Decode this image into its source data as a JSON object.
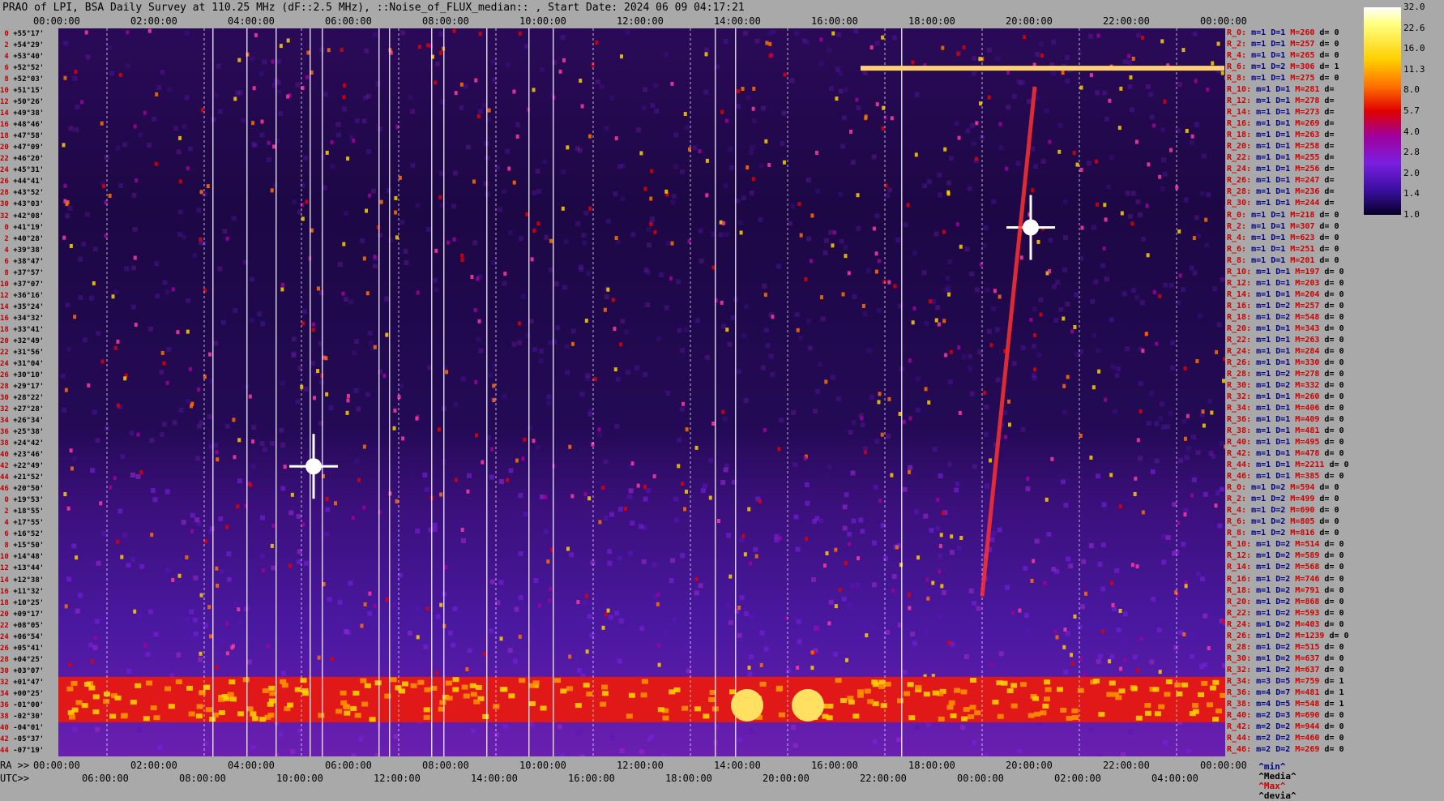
{
  "title": "PRAO of LPI, BSA Daily Survey at 110.25 MHz (dF::2.5 MHz), ::Noise_of_FLUX_median:: , Start Date: 2024 06 09 04:17:21",
  "top_axis": [
    "00:00:00",
    "02:00:00",
    "04:00:00",
    "06:00:00",
    "08:00:00",
    "10:00:00",
    "12:00:00",
    "14:00:00",
    "16:00:00",
    "18:00:00",
    "20:00:00",
    "22:00:00",
    "00:00:00"
  ],
  "bottom_axis_prefix": "RA >>",
  "bottom_axis": [
    "00:00:00",
    "02:00:00",
    "04:00:00",
    "06:00:00",
    "08:00:00",
    "10:00:00",
    "12:00:00",
    "14:00:00",
    "16:00:00",
    "18:00:00",
    "20:00:00",
    "22:00:00",
    "00:00:00"
  ],
  "utc_prefix": "UTC>>",
  "utc_axis": [
    "06:00:00",
    "08:00:00",
    "10:00:00",
    "12:00:00",
    "14:00:00",
    "16:00:00",
    "18:00:00",
    "20:00:00",
    "22:00:00",
    "00:00:00",
    "02:00:00",
    "04:00:00"
  ],
  "colors": {
    "background": "#a9a9a9",
    "plot_dark": "#1d0745",
    "band": "#ff3000",
    "hot": "#ffff80"
  },
  "chart_data": {
    "type": "heatmap",
    "title": "PRAO of LPI, BSA Daily Survey at 110.25 MHz (dF::2.5 MHz), ::Noise_of_FLUX_median:: , Start Date: 2024 06 09 04:17:21",
    "x_axis_ra": [
      "00:00:00",
      "02:00:00",
      "04:00:00",
      "06:00:00",
      "08:00:00",
      "10:00:00",
      "12:00:00",
      "14:00:00",
      "16:00:00",
      "18:00:00",
      "20:00:00",
      "22:00:00",
      "00:00:00"
    ],
    "x_axis_utc": [
      "06:00:00",
      "08:00:00",
      "10:00:00",
      "12:00:00",
      "14:00:00",
      "16:00:00",
      "18:00:00",
      "20:00:00",
      "22:00:00",
      "00:00:00",
      "02:00:00",
      "04:00:00"
    ],
    "y_rows": [
      {
        "i": "0",
        "dec": "+55°17'"
      },
      {
        "i": "2",
        "dec": "+54°29'"
      },
      {
        "i": "4",
        "dec": "+53°40'"
      },
      {
        "i": "6",
        "dec": "+52°52'"
      },
      {
        "i": "8",
        "dec": "+52°03'"
      },
      {
        "i": "10",
        "dec": "+51°15'"
      },
      {
        "i": "12",
        "dec": "+50°26'"
      },
      {
        "i": "14",
        "dec": "+49°38'"
      },
      {
        "i": "16",
        "dec": "+48°46'"
      },
      {
        "i": "18",
        "dec": "+47°58'"
      },
      {
        "i": "20",
        "dec": "+47°09'"
      },
      {
        "i": "22",
        "dec": "+46°20'"
      },
      {
        "i": "24",
        "dec": "+45°31'"
      },
      {
        "i": "26",
        "dec": "+44°41'"
      },
      {
        "i": "28",
        "dec": "+43°52'"
      },
      {
        "i": "30",
        "dec": "+43°03'"
      },
      {
        "i": "32",
        "dec": "+42°08'"
      },
      {
        "i": "0",
        "dec": "+41°19'"
      },
      {
        "i": "2",
        "dec": "+40°28'"
      },
      {
        "i": "4",
        "dec": "+39°38'"
      },
      {
        "i": "6",
        "dec": "+38°47'"
      },
      {
        "i": "8",
        "dec": "+37°57'"
      },
      {
        "i": "10",
        "dec": "+37°07'"
      },
      {
        "i": "12",
        "dec": "+36°16'"
      },
      {
        "i": "14",
        "dec": "+35°24'"
      },
      {
        "i": "16",
        "dec": "+34°32'"
      },
      {
        "i": "18",
        "dec": "+33°41'"
      },
      {
        "i": "20",
        "dec": "+32°49'"
      },
      {
        "i": "22",
        "dec": "+31°56'"
      },
      {
        "i": "24",
        "dec": "+31°04'"
      },
      {
        "i": "26",
        "dec": "+30°10'"
      },
      {
        "i": "28",
        "dec": "+29°17'"
      },
      {
        "i": "30",
        "dec": "+28°22'"
      },
      {
        "i": "32",
        "dec": "+27°28'"
      },
      {
        "i": "34",
        "dec": "+26°34'"
      },
      {
        "i": "36",
        "dec": "+25°38'"
      },
      {
        "i": "38",
        "dec": "+24°42'"
      },
      {
        "i": "40",
        "dec": "+23°46'"
      },
      {
        "i": "42",
        "dec": "+22°49'"
      },
      {
        "i": "44",
        "dec": "+21°52'"
      },
      {
        "i": "46",
        "dec": "+20°50'"
      },
      {
        "i": "0",
        "dec": "+19°53'"
      },
      {
        "i": "2",
        "dec": "+18°55'"
      },
      {
        "i": "4",
        "dec": "+17°55'"
      },
      {
        "i": "6",
        "dec": "+16°52'"
      },
      {
        "i": "8",
        "dec": "+15°50'"
      },
      {
        "i": "10",
        "dec": "+14°48'"
      },
      {
        "i": "12",
        "dec": "+13°44'"
      },
      {
        "i": "14",
        "dec": "+12°38'"
      },
      {
        "i": "16",
        "dec": "+11°32'"
      },
      {
        "i": "18",
        "dec": "+10°25'"
      },
      {
        "i": "20",
        "dec": "+09°17'"
      },
      {
        "i": "22",
        "dec": "+08°05'"
      },
      {
        "i": "24",
        "dec": "+06°54'"
      },
      {
        "i": "26",
        "dec": "+05°41'"
      },
      {
        "i": "28",
        "dec": "+04°25'"
      },
      {
        "i": "30",
        "dec": "+03°07'"
      },
      {
        "i": "32",
        "dec": "+01°47'"
      },
      {
        "i": "34",
        "dec": "+00°25'"
      },
      {
        "i": "36",
        "dec": "-01°00'"
      },
      {
        "i": "38",
        "dec": "-02°30'"
      },
      {
        "i": "40",
        "dec": "-04°01'"
      },
      {
        "i": "42",
        "dec": "-05°37'"
      },
      {
        "i": "44",
        "dec": "-07°19'"
      }
    ],
    "stats_rows": [
      {
        "r": "R_0:",
        "md": "m=1 D=1",
        "m": "M=260",
        "d": "d= 0"
      },
      {
        "r": "R_2:",
        "md": "m=1 D=1",
        "m": "M=257",
        "d": "d= 0"
      },
      {
        "r": "R_4:",
        "md": "m=1 D=1",
        "m": "M=265",
        "d": "d= 0"
      },
      {
        "r": "R_6:",
        "md": "m=1 D=2",
        "m": "M=306",
        "d": "d= 1"
      },
      {
        "r": "R_8:",
        "md": "m=1 D=1",
        "m": "M=275",
        "d": "d= 0"
      },
      {
        "r": "R_10:",
        "md": "m=1 D=1",
        "m": "M=281",
        "d": "d="
      },
      {
        "r": "R_12:",
        "md": "m=1 D=1",
        "m": "M=278",
        "d": "d="
      },
      {
        "r": "R_14:",
        "md": "m=1 D=1",
        "m": "M=273",
        "d": "d="
      },
      {
        "r": "R_16:",
        "md": "m=1 D=1",
        "m": "M=269",
        "d": "d="
      },
      {
        "r": "R_18:",
        "md": "m=1 D=1",
        "m": "M=263",
        "d": "d="
      },
      {
        "r": "R_20:",
        "md": "m=1 D=1",
        "m": "M=258",
        "d": "d="
      },
      {
        "r": "R_22:",
        "md": "m=1 D=1",
        "m": "M=255",
        "d": "d="
      },
      {
        "r": "R_24:",
        "md": "m=1 D=1",
        "m": "M=256",
        "d": "d="
      },
      {
        "r": "R_26:",
        "md": "m=1 D=1",
        "m": "M=247",
        "d": "d="
      },
      {
        "r": "R_28:",
        "md": "m=1 D=1",
        "m": "M=236",
        "d": "d="
      },
      {
        "r": "R_30:",
        "md": "m=1 D=1",
        "m": "M=244",
        "d": "d="
      },
      {
        "r": "R_0:",
        "md": "m=1 D=1",
        "m": "M=218",
        "d": "d= 0"
      },
      {
        "r": "R_2:",
        "md": "m=1 D=1",
        "m": "M=307",
        "d": "d= 0"
      },
      {
        "r": "R_4:",
        "md": "m=1 D=1",
        "m": "M=623",
        "d": "d= 0"
      },
      {
        "r": "R_6:",
        "md": "m=1 D=1",
        "m": "M=251",
        "d": "d= 0"
      },
      {
        "r": "R_8:",
        "md": "m=1 D=1",
        "m": "M=201",
        "d": "d= 0"
      },
      {
        "r": "R_10:",
        "md": "m=1 D=1",
        "m": "M=197",
        "d": "d= 0"
      },
      {
        "r": "R_12:",
        "md": "m=1 D=1",
        "m": "M=203",
        "d": "d= 0"
      },
      {
        "r": "R_14:",
        "md": "m=1 D=1",
        "m": "M=204",
        "d": "d= 0"
      },
      {
        "r": "R_16:",
        "md": "m=1 D=2",
        "m": "M=257",
        "d": "d= 0"
      },
      {
        "r": "R_18:",
        "md": "m=1 D=2",
        "m": "M=548",
        "d": "d= 0"
      },
      {
        "r": "R_20:",
        "md": "m=1 D=1",
        "m": "M=343",
        "d": "d= 0"
      },
      {
        "r": "R_22:",
        "md": "m=1 D=1",
        "m": "M=263",
        "d": "d= 0"
      },
      {
        "r": "R_24:",
        "md": "m=1 D=1",
        "m": "M=284",
        "d": "d= 0"
      },
      {
        "r": "R_26:",
        "md": "m=1 D=1",
        "m": "M=330",
        "d": "d= 0"
      },
      {
        "r": "R_28:",
        "md": "m=1 D=2",
        "m": "M=278",
        "d": "d= 0"
      },
      {
        "r": "R_30:",
        "md": "m=1 D=2",
        "m": "M=332",
        "d": "d= 0"
      },
      {
        "r": "R_32:",
        "md": "m=1 D=1",
        "m": "M=260",
        "d": "d= 0"
      },
      {
        "r": "R_34:",
        "md": "m=1 D=1",
        "m": "M=406",
        "d": "d= 0"
      },
      {
        "r": "R_36:",
        "md": "m=1 D=1",
        "m": "M=409",
        "d": "d= 0"
      },
      {
        "r": "R_38:",
        "md": "m=1 D=1",
        "m": "M=481",
        "d": "d= 0"
      },
      {
        "r": "R_40:",
        "md": "m=1 D=1",
        "m": "M=495",
        "d": "d= 0"
      },
      {
        "r": "R_42:",
        "md": "m=1 D=1",
        "m": "M=478",
        "d": "d= 0"
      },
      {
        "r": "R_44:",
        "md": "m=1 D=1",
        "m": "M=2211",
        "d": "d= 0"
      },
      {
        "r": "R_46:",
        "md": "m=1 D=1",
        "m": "M=385",
        "d": "d= 0"
      },
      {
        "r": "R_0:",
        "md": "m=1 D=2",
        "m": "M=594",
        "d": "d= 0"
      },
      {
        "r": "R_2:",
        "md": "m=1 D=2",
        "m": "M=499",
        "d": "d= 0"
      },
      {
        "r": "R_4:",
        "md": "m=1 D=2",
        "m": "M=690",
        "d": "d= 0"
      },
      {
        "r": "R_6:",
        "md": "m=1 D=2",
        "m": "M=805",
        "d": "d= 0"
      },
      {
        "r": "R_8:",
        "md": "m=1 D=2",
        "m": "M=816",
        "d": "d= 0"
      },
      {
        "r": "R_10:",
        "md": "m=1 D=2",
        "m": "M=514",
        "d": "d= 0"
      },
      {
        "r": "R_12:",
        "md": "m=1 D=2",
        "m": "M=589",
        "d": "d= 0"
      },
      {
        "r": "R_14:",
        "md": "m=1 D=2",
        "m": "M=568",
        "d": "d= 0"
      },
      {
        "r": "R_16:",
        "md": "m=1 D=2",
        "m": "M=746",
        "d": "d= 0"
      },
      {
        "r": "R_18:",
        "md": "m=1 D=2",
        "m": "M=791",
        "d": "d= 0"
      },
      {
        "r": "R_20:",
        "md": "m=1 D=2",
        "m": "M=868",
        "d": "d= 0"
      },
      {
        "r": "R_22:",
        "md": "m=1 D=2",
        "m": "M=593",
        "d": "d= 0"
      },
      {
        "r": "R_24:",
        "md": "m=1 D=2",
        "m": "M=403",
        "d": "d= 0"
      },
      {
        "r": "R_26:",
        "md": "m=1 D=2",
        "m": "M=1239",
        "d": "d= 0"
      },
      {
        "r": "R_28:",
        "md": "m=1 D=2",
        "m": "M=515",
        "d": "d= 0"
      },
      {
        "r": "R_30:",
        "md": "m=1 D=2",
        "m": "M=637",
        "d": "d= 0"
      },
      {
        "r": "R_32:",
        "md": "m=1 D=2",
        "m": "M=637",
        "d": "d= 0"
      },
      {
        "r": "R_34:",
        "md": "m=3 D=5",
        "m": "M=759",
        "d": "d= 1"
      },
      {
        "r": "R_36:",
        "md": "m=4 D=7",
        "m": "M=481",
        "d": "d= 1"
      },
      {
        "r": "R_38:",
        "md": "m=4 D=5",
        "m": "M=548",
        "d": "d= 1"
      },
      {
        "r": "R_40:",
        "md": "m=2 D=3",
        "m": "M=690",
        "d": "d= 0"
      },
      {
        "r": "R_42:",
        "md": "m=2 D=2",
        "m": "M=944",
        "d": "d= 0"
      },
      {
        "r": "R_44:",
        "md": "m=2 D=2",
        "m": "M=460",
        "d": "d= 0"
      },
      {
        "r": "R_46:",
        "md": "m=2 D=2",
        "m": "M=269",
        "d": "d= 0"
      }
    ],
    "colorbar_ticks": [
      "32.0",
      "22.6",
      "16.0",
      "11.3",
      "8.0",
      "5.7",
      "4.0",
      "2.8",
      "2.0",
      "1.4",
      "1.0"
    ],
    "colorbar_colors": [
      "#ffffff",
      "#ffff80",
      "#ffd000",
      "#ff7000",
      "#e00000",
      "#a0009c",
      "#7a1fe0",
      "#3a0fa0",
      "#08002a"
    ],
    "features": [
      {
        "name": "equatorial interference band",
        "dec_from": "+01°47'",
        "dec_to": "-02°30'",
        "color": "#ff2800"
      },
      {
        "name": "strong source",
        "ra": "20:00:00",
        "dec": "+41°19'"
      },
      {
        "name": "strong source",
        "ra": "05:15:00",
        "dec": "+22°49'"
      },
      {
        "name": "hot spot",
        "ra": "14:10:00",
        "dec": "-01°00'"
      },
      {
        "name": "hot spot",
        "ra": "15:25:00",
        "dec": "-01°00'"
      },
      {
        "name": "horizontal streak",
        "ra_from": "16:30:00",
        "ra_to": "23:59:00",
        "dec": "+52°52'"
      }
    ],
    "legend": {
      "min": "^min^",
      "median": "^Media^",
      "max": "^Max^",
      "dev": "^devia^"
    }
  }
}
